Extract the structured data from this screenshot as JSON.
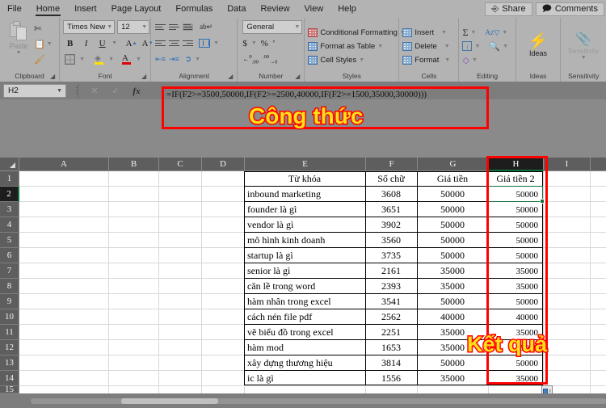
{
  "window": {
    "ribbon_tabs": [
      {
        "label": "File"
      },
      {
        "label": "Home"
      },
      {
        "label": "Insert"
      },
      {
        "label": "Page Layout"
      },
      {
        "label": "Formulas"
      },
      {
        "label": "Data"
      },
      {
        "label": "Review"
      },
      {
        "label": "View"
      },
      {
        "label": "Help"
      }
    ],
    "share_label": "Share",
    "comments_label": "Comments"
  },
  "ribbon": {
    "clipboard": {
      "paste_label": "Paste",
      "group_label": "Clipboard",
      "cut_icon": "scissors-icon",
      "copy_icon": "copy-icon",
      "format_painter_icon": "paintbrush-icon"
    },
    "font": {
      "font_name": "Times New Rc",
      "font_size": "12",
      "group_label": "Font",
      "bold_label": "B",
      "italic_label": "I",
      "underline_label": "U",
      "grow_label": "A",
      "shrink_label": "A",
      "fill_label": "A"
    },
    "alignment": {
      "group_label": "Alignment",
      "wrap_label": "ab"
    },
    "number": {
      "format_value": "General",
      "group_label": "Number",
      "currency_label": "$",
      "percent_label": "%",
      "comma_label": "‰",
      "inc_dec_label": ".00",
      "dec_dec_label": ".00"
    },
    "styles": {
      "group_label": "Styles",
      "items": [
        {
          "label": "Conditional Formatting"
        },
        {
          "label": "Format as Table"
        },
        {
          "label": "Cell Styles"
        }
      ]
    },
    "cells": {
      "group_label": "Cells",
      "items": [
        {
          "label": "Insert"
        },
        {
          "label": "Delete"
        },
        {
          "label": "Format"
        }
      ]
    },
    "editing": {
      "group_label": "Editing",
      "autosum_icon": "sigma-icon",
      "fill_icon": "fill-down-icon",
      "clear_icon": "eraser-icon",
      "sort_icon": "sort-filter-icon",
      "find_icon": "magnifier-icon"
    },
    "ideas": {
      "group_label": "Ideas",
      "label": "Ideas",
      "icon": "lightning-bolt-icon"
    },
    "sensitivity": {
      "group_label": "Sensitivity",
      "label": "Sensitivity",
      "icon": "paperclip-icon"
    }
  },
  "formula_bar": {
    "name_box": "H2",
    "formula": "=IF(F2>=3500,50000,IF(F2>=2500,40000,IF(F2>=1500,35000,30000)))",
    "cancel_icon": "x-icon",
    "enter_icon": "check-icon",
    "insert_function_icon": "fx-icon"
  },
  "annotations": {
    "formula_callout": "Công thức",
    "result_callout": "Kết quả",
    "highlight_color": "#ff0000",
    "callout_fill": "#ffe01a"
  },
  "sheet": {
    "columns": [
      "A",
      "B",
      "C",
      "D",
      "E",
      "F",
      "G",
      "H",
      "I"
    ],
    "selected_column": "H",
    "selected_row": "2",
    "rows": [
      "1",
      "2",
      "3",
      "4",
      "5",
      "6",
      "7",
      "8",
      "9",
      "10",
      "11",
      "12",
      "13",
      "14",
      "15"
    ],
    "headers": {
      "E": "Từ khóa",
      "F": "Số chữ",
      "G": "Giá tiền",
      "H": "Giá tiền 2"
    },
    "data": [
      {
        "row": "2",
        "keyword": "inbound marketing",
        "chars": "3608",
        "price": "50000",
        "price2": "50000"
      },
      {
        "row": "3",
        "keyword": "founder là gì",
        "chars": "3651",
        "price": "50000",
        "price2": "50000"
      },
      {
        "row": "4",
        "keyword": "vendor là gì",
        "chars": "3902",
        "price": "50000",
        "price2": "50000"
      },
      {
        "row": "5",
        "keyword": "mô hình kinh doanh",
        "chars": "3560",
        "price": "50000",
        "price2": "50000"
      },
      {
        "row": "6",
        "keyword": "startup là gì",
        "chars": "3735",
        "price": "50000",
        "price2": "50000"
      },
      {
        "row": "7",
        "keyword": "senior là gì",
        "chars": "2161",
        "price": "35000",
        "price2": "35000"
      },
      {
        "row": "8",
        "keyword": "căn lề trong word",
        "chars": "2393",
        "price": "35000",
        "price2": "35000"
      },
      {
        "row": "9",
        "keyword": "hàm nhân trong excel",
        "chars": "3541",
        "price": "50000",
        "price2": "50000"
      },
      {
        "row": "10",
        "keyword": "cách nén file pdf",
        "chars": "2562",
        "price": "40000",
        "price2": "40000"
      },
      {
        "row": "11",
        "keyword": "vẽ biểu đồ trong excel",
        "chars": "2251",
        "price": "35000",
        "price2": "35000"
      },
      {
        "row": "12",
        "keyword": "hàm mod",
        "chars": "1653",
        "price": "35000",
        "price2": "35000"
      },
      {
        "row": "13",
        "keyword": "xây dựng thương hiệu",
        "chars": "3814",
        "price": "50000",
        "price2": "50000"
      },
      {
        "row": "14",
        "keyword": "ic là gì",
        "chars": "1556",
        "price": "35000",
        "price2": "35000"
      }
    ],
    "autofill_icon": "autofill-options-icon"
  }
}
